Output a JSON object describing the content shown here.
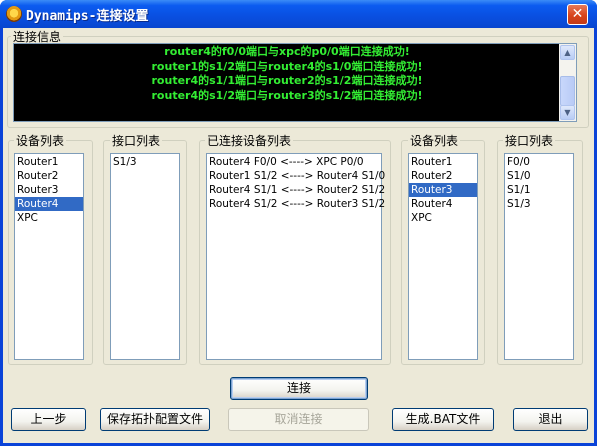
{
  "window": {
    "title": "Dynamips-连接设置",
    "close_glyph": "✕"
  },
  "info": {
    "label": "连接信息",
    "lines": [
      "router4的f0/0端口与xpc的p0/0端口连接成功!",
      "router1的s1/2端口与router4的s1/0端口连接成功!",
      "router4的s1/1端口与router2的s1/2端口连接成功!",
      "router4的s1/2端口与router3的s1/2端口连接成功!"
    ],
    "text_color": "#33ee33"
  },
  "left_devices": {
    "label": "设备列表",
    "items": [
      "Router1",
      "Router2",
      "Router3",
      "Router4",
      "XPC"
    ],
    "selected": 3
  },
  "left_ports": {
    "label": "接口列表",
    "items": [
      "S1/3"
    ]
  },
  "connected": {
    "label": "已连接设备列表",
    "items": [
      "Router4 F0/0 <----> XPC P0/0",
      "Router1 S1/2 <----> Router4 S1/0",
      "Router4 S1/1 <----> Router2 S1/2",
      "Router4 S1/2 <----> Router3 S1/2"
    ]
  },
  "right_devices": {
    "label": "设备列表",
    "items": [
      "Router1",
      "Router2",
      "Router3",
      "Router4",
      "XPC"
    ],
    "selected": 2
  },
  "right_ports": {
    "label": "接口列表",
    "items": [
      "F0/0",
      "S1/0",
      "S1/1",
      "S1/3"
    ]
  },
  "buttons": {
    "connect": "连接",
    "prev": "上一步",
    "save": "保存拓扑配置文件",
    "cancel": "取消连接",
    "gen_bat": "生成.BAT文件",
    "exit": "退出"
  },
  "icons": {
    "app": "dynamips-app-icon",
    "close": "close-icon",
    "scroll_up": "scroll-up-arrow-icon",
    "scroll_down": "scroll-down-arrow-icon"
  },
  "colors": {
    "titlebar": "#0a4fe0",
    "selection": "#316ac5",
    "dialog_bg": "#ece9d8"
  }
}
